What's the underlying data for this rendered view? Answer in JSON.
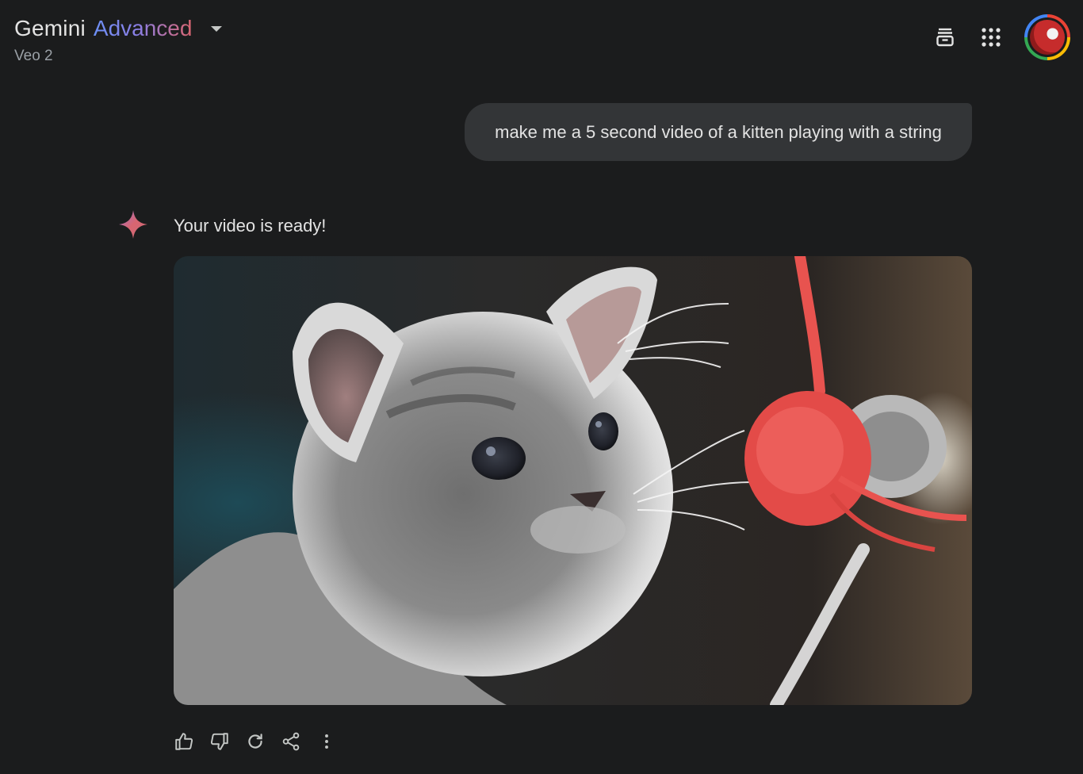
{
  "header": {
    "title": "Gemini",
    "title_accent": "Advanced",
    "subtitle": "Veo 2",
    "icons": [
      "chevron-down-icon",
      "archive-icon",
      "apps-grid-icon",
      "account-avatar"
    ]
  },
  "conversation": {
    "user_prompt": "make me a 5 second video of a kitten playing with a string",
    "response_text": "Your video is ready!",
    "video": {
      "description_icon": "gemini-spark-icon"
    }
  },
  "response_actions": [
    "thumbs-up-icon",
    "thumbs-down-icon",
    "regenerate-icon",
    "share-icon",
    "more-vert-icon"
  ],
  "colors": {
    "background": "#1b1c1d",
    "bubble": "#333537",
    "text": "#e3e3e3",
    "muted": "#9aa0a6",
    "accent_blue": "#6c8ff5",
    "accent_red": "#d96570"
  }
}
